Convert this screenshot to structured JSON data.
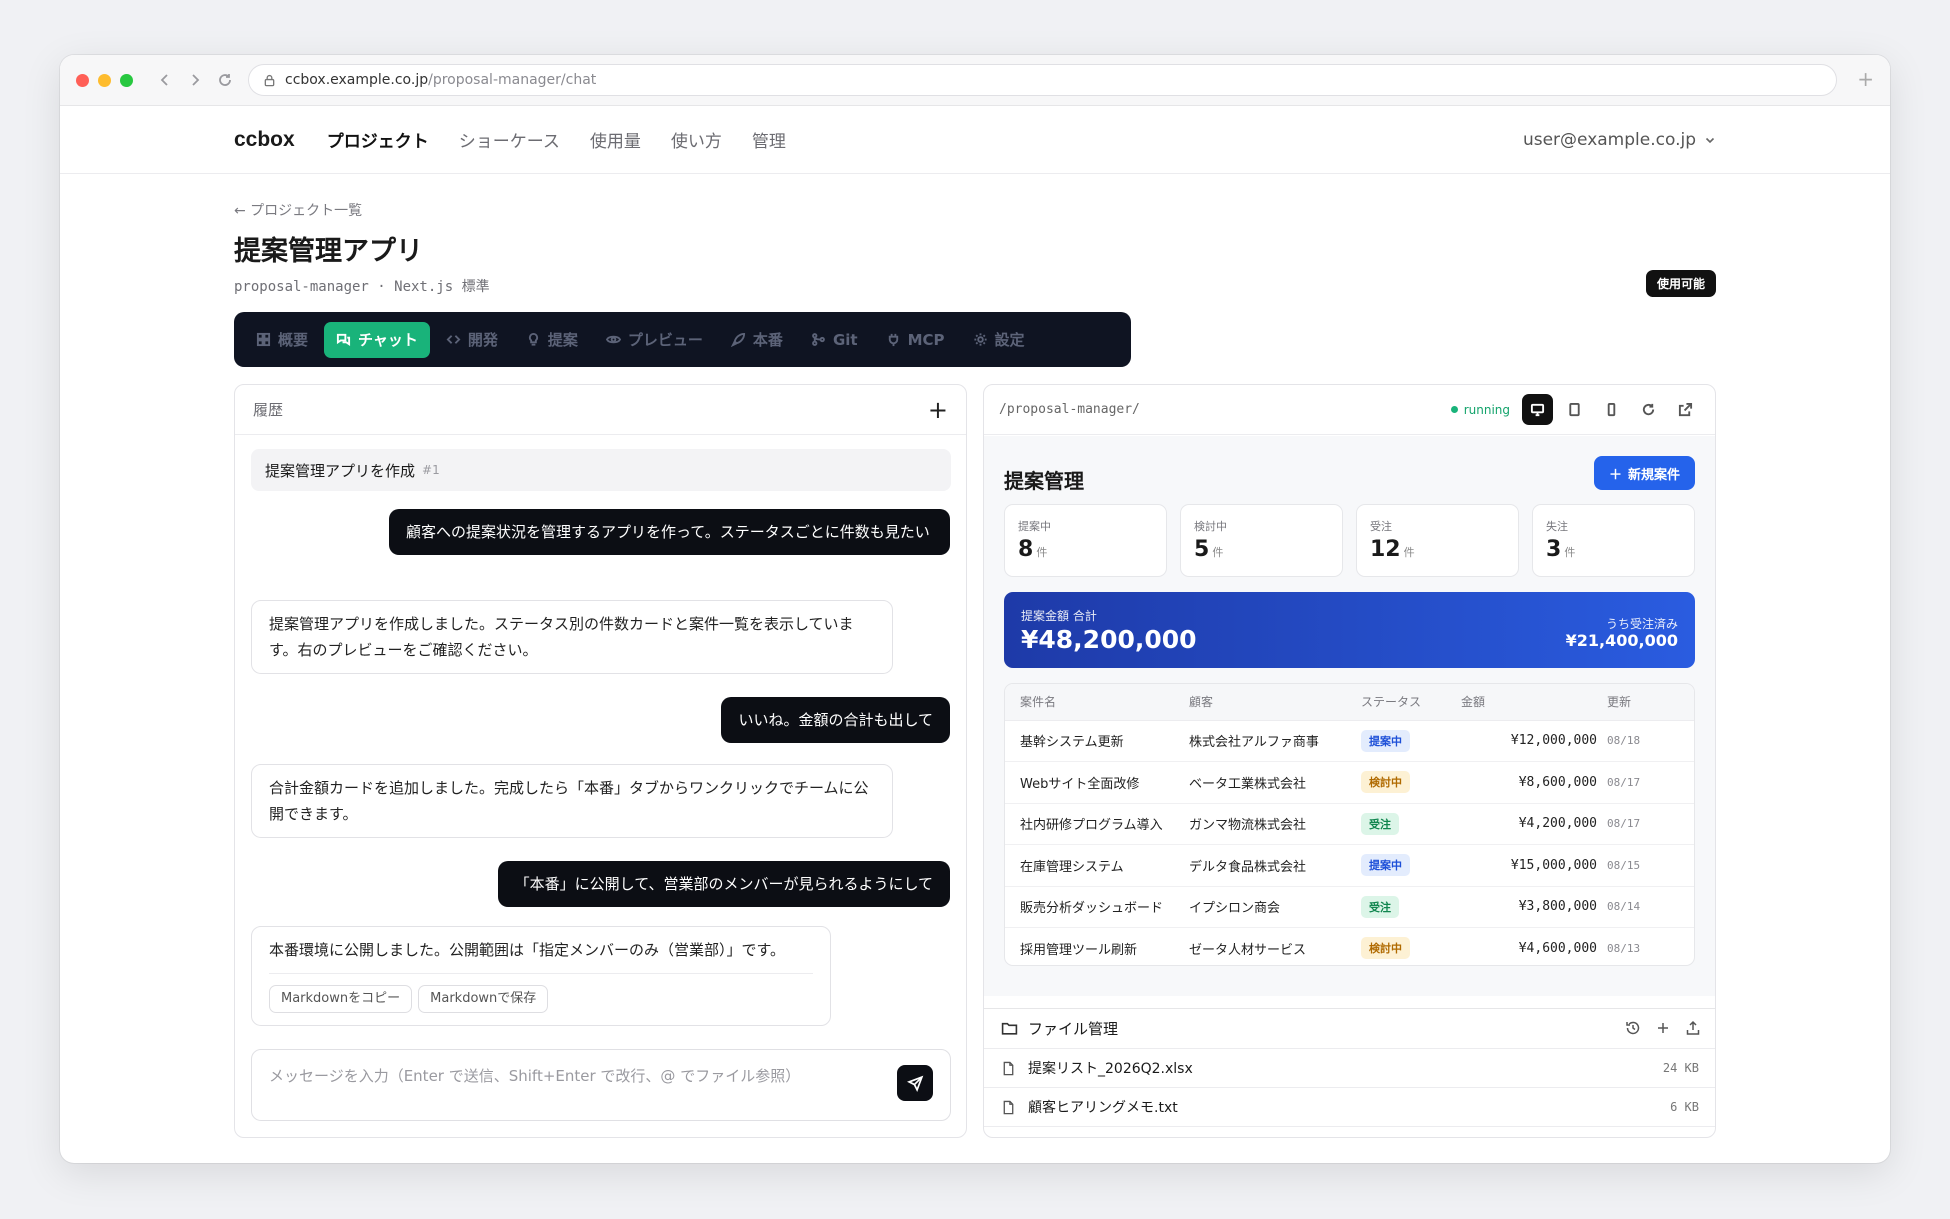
{
  "browser": {
    "url_host": "ccbox.example.co.jp",
    "url_path": "/proposal-manager/chat"
  },
  "nav": {
    "brand": "ccbox",
    "links": [
      "プロジェクト",
      "ショーケース",
      "使用量",
      "使い方",
      "管理"
    ],
    "user": "user@example.co.jp"
  },
  "project": {
    "back": "← プロジェクト一覧",
    "title": "提案管理アプリ",
    "subtitle": "proposal-manager · Next.js 標準",
    "status_badge": "使用可能"
  },
  "tabs": [
    {
      "label": "概要",
      "icon": "grid-icon"
    },
    {
      "label": "チャット",
      "icon": "chat-icon",
      "active": true
    },
    {
      "label": "開発",
      "icon": "code-icon"
    },
    {
      "label": "提案",
      "icon": "bulb-icon"
    },
    {
      "label": "プレビュー",
      "icon": "eye-icon"
    },
    {
      "label": "本番",
      "icon": "rocket-icon"
    },
    {
      "label": "Git",
      "icon": "git-icon"
    },
    {
      "label": "MCP",
      "icon": "plug-icon"
    },
    {
      "label": "設定",
      "icon": "gear-icon"
    }
  ],
  "chat": {
    "header": "履歴",
    "history_title": "提案管理アプリを作成",
    "history_num": "#1",
    "messages": [
      {
        "role": "user",
        "text": "顧客への提案状況を管理するアプリを作って。ステータスごとに件数も見たい"
      },
      {
        "role": "bot",
        "text": "提案管理アプリを作成しました。ステータス別の件数カードと案件一覧を表示しています。右のプレビューをご確認ください。"
      },
      {
        "role": "user",
        "text": "いいね。金額の合計も出して"
      },
      {
        "role": "bot",
        "text": "合計金額カードを追加しました。完成したら「本番」タブからワンクリックでチームに公開できます。"
      },
      {
        "role": "user",
        "text": "「本番」に公開して、営業部のメンバーが見られるようにして"
      },
      {
        "role": "bot",
        "text": "本番環境に公開しました。公開範囲は「指定メンバーのみ（営業部）」です。"
      }
    ],
    "copy_md": "Markdownをコピー",
    "save_md": "Markdownで保存",
    "input_placeholder": "メッセージを入力（Enter で送信、Shift+Enter で改行、@ でファイル参照）"
  },
  "preview": {
    "path": "/proposal-manager/",
    "status": "running",
    "app": {
      "title": "提案管理",
      "new_button": "新規案件",
      "stats": [
        {
          "label": "提案中",
          "value": "8",
          "unit": "件"
        },
        {
          "label": "検討中",
          "value": "5",
          "unit": "件"
        },
        {
          "label": "受注",
          "value": "12",
          "unit": "件"
        },
        {
          "label": "失注",
          "value": "3",
          "unit": "件"
        }
      ],
      "total_label": "提案金額 合計",
      "total_value": "¥48,200,000",
      "won_label": "うち受注済み",
      "won_value": "¥21,400,000",
      "columns": [
        "案件名",
        "顧客",
        "ステータス",
        "金額",
        "更新"
      ],
      "rows": [
        {
          "name": "基幹システム更新",
          "client": "株式会社アルファ商事",
          "status": "提案中",
          "amount": "¥12,000,000",
          "date": "08/18"
        },
        {
          "name": "Webサイト全面改修",
          "client": "ベータ工業株式会社",
          "status": "検討中",
          "amount": "¥8,600,000",
          "date": "08/17"
        },
        {
          "name": "社内研修プログラム導入",
          "client": "ガンマ物流株式会社",
          "status": "受注",
          "amount": "¥4,200,000",
          "date": "08/17"
        },
        {
          "name": "在庫管理システム",
          "client": "デルタ食品株式会社",
          "status": "提案中",
          "amount": "¥15,000,000",
          "date": "08/15"
        },
        {
          "name": "販売分析ダッシュボード",
          "client": "イプシロン商会",
          "status": "受注",
          "amount": "¥3,800,000",
          "date": "08/14"
        },
        {
          "name": "採用管理ツール刷新",
          "client": "ゼータ人材サービス",
          "status": "検討中",
          "amount": "¥4,600,000",
          "date": "08/13"
        }
      ]
    },
    "files": {
      "header": "ファイル管理",
      "items": [
        {
          "name": "提案リスト_2026Q2.xlsx",
          "size": "24 KB"
        },
        {
          "name": "顧客ヒアリングメモ.txt",
          "size": "6 KB"
        }
      ]
    }
  },
  "colors": {
    "accent_green": "#19b37a",
    "primary_blue": "#2563eb",
    "status_proposal_bg": "#e3ecfd",
    "status_proposal_fg": "#1d4fd8",
    "status_review_bg": "#fdf1d4",
    "status_review_fg": "#b06a00",
    "status_won_bg": "#dcf5e8",
    "status_won_fg": "#11864f"
  }
}
